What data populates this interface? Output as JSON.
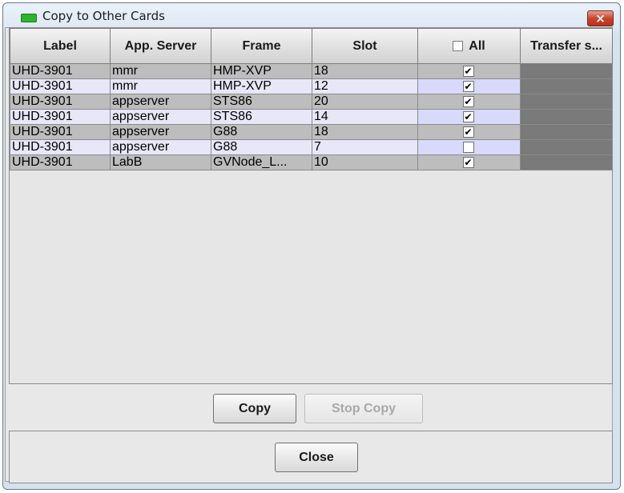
{
  "window": {
    "title": "Copy to Other Cards",
    "close_glyph": "×"
  },
  "table": {
    "columns": [
      "Label",
      "App. Server",
      "Frame",
      "Slot",
      "All",
      "Transfer s..."
    ],
    "rows": [
      {
        "label": "UHD-3901",
        "server": "mmr",
        "frame": "HMP-XVP",
        "slot": "18",
        "checked": true
      },
      {
        "label": "UHD-3901",
        "server": "mmr",
        "frame": "HMP-XVP",
        "slot": "12",
        "checked": true
      },
      {
        "label": "UHD-3901",
        "server": "appserver",
        "frame": "STS86",
        "slot": "20",
        "checked": true
      },
      {
        "label": "UHD-3901",
        "server": "appserver",
        "frame": "STS86",
        "slot": "14",
        "checked": true
      },
      {
        "label": "UHD-3901",
        "server": "appserver",
        "frame": "G88",
        "slot": "18",
        "checked": true
      },
      {
        "label": "UHD-3901",
        "server": "appserver",
        "frame": "G88",
        "slot": "7",
        "checked": false
      },
      {
        "label": "UHD-3901",
        "server": "LabB",
        "frame": "GVNode_L...",
        "slot": "10",
        "checked": true
      }
    ]
  },
  "buttons": {
    "copy": "Copy",
    "stop_copy": "Stop Copy",
    "close": "Close"
  },
  "colors": {
    "accent_icon": "#2db32d",
    "close_button": "#c8452f",
    "transfer_cell": "#7a7a7a"
  }
}
